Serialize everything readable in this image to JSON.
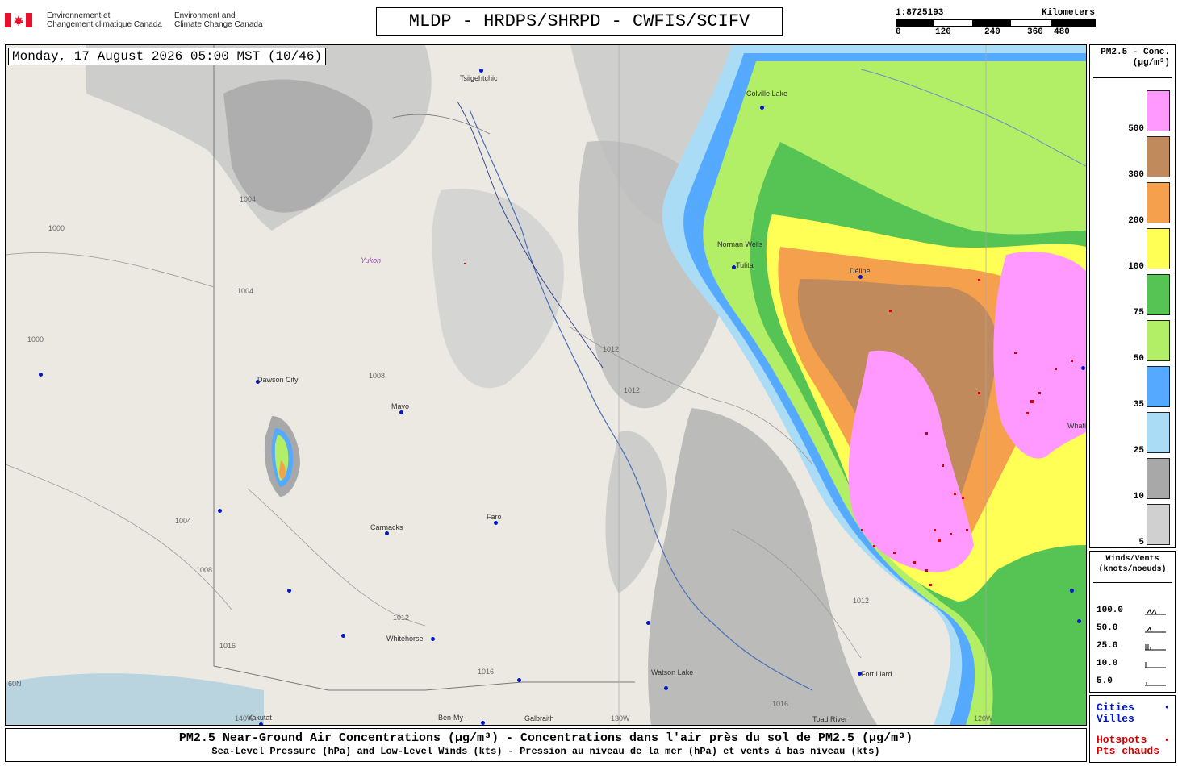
{
  "header": {
    "agency_fr": "Environnement et\nChangement climatique Canada",
    "agency_en": "Environment and\nClimate Change Canada",
    "title": "MLDP - HRDPS/SHRPD - CWFIS/SCIFV",
    "scale": {
      "ratio": "1:8725193",
      "unit": "Kilometers",
      "ticks": [
        "0",
        "120",
        "240",
        "360",
        "480"
      ]
    }
  },
  "map": {
    "timestamp": "Monday, 17 August 2026 05:00 MST (10/46)",
    "region_label": "Yukon",
    "cities": [
      {
        "name": "Tsiigehtchic"
      },
      {
        "name": "Colville Lake"
      },
      {
        "name": "Norman Wells"
      },
      {
        "name": "Tulita"
      },
      {
        "name": "Déline"
      },
      {
        "name": "Dawson City"
      },
      {
        "name": "Mayo"
      },
      {
        "name": "Faro"
      },
      {
        "name": "Carmacks"
      },
      {
        "name": "Whitehorse"
      },
      {
        "name": "Watson Lake"
      },
      {
        "name": "Fort Liard"
      },
      {
        "name": "Yakutat"
      },
      {
        "name": "Ben-My-"
      },
      {
        "name": "Galbraith"
      },
      {
        "name": "Toad River"
      },
      {
        "name": "Whati"
      }
    ],
    "isobars": [
      "1000",
      "1004",
      "1008",
      "1012",
      "1016"
    ],
    "meridians": [
      "140W",
      "130W",
      "120W"
    ],
    "parallel": "60N"
  },
  "legend_pm": {
    "title_line1": "PM2.5 - Conc.",
    "title_line2": "(µg/m³)",
    "bins": [
      {
        "label": "500",
        "color": "#ff99ff"
      },
      {
        "label": "300",
        "color": "#c08a5c"
      },
      {
        "label": "200",
        "color": "#f5a04c"
      },
      {
        "label": "100",
        "color": "#ffff55"
      },
      {
        "label": "75",
        "color": "#55c455"
      },
      {
        "label": "50",
        "color": "#b2ee66"
      },
      {
        "label": "35",
        "color": "#55aaff"
      },
      {
        "label": "25",
        "color": "#aaddf5"
      },
      {
        "label": "10",
        "color": "#a8a8a8"
      },
      {
        "label": "5",
        "color": "#d0d0d0"
      }
    ]
  },
  "legend_wind": {
    "title_line1": "Winds/Vents",
    "title_line2": "(knots/noeuds)",
    "rows": [
      "100.0",
      "50.0",
      "25.0",
      "10.0",
      "5.0"
    ]
  },
  "legend_points": {
    "cities_en": "Cities",
    "cities_fr": "Villes",
    "hotspots_en": "Hotspots",
    "hotspots_fr": "Pts chauds",
    "city_color": "#0016c8",
    "hotspot_color": "#d40000"
  },
  "footer": {
    "main": "PM2.5 Near-Ground Air Concentrations (µg/m³) - Concentrations dans l'air près du sol de PM2.5 (µg/m³)",
    "sub": "Sea-Level Pressure (hPa) and Low-Level Winds (kts) - Pression au niveau de la mer (hPa) et vents à bas niveau (kts)"
  }
}
